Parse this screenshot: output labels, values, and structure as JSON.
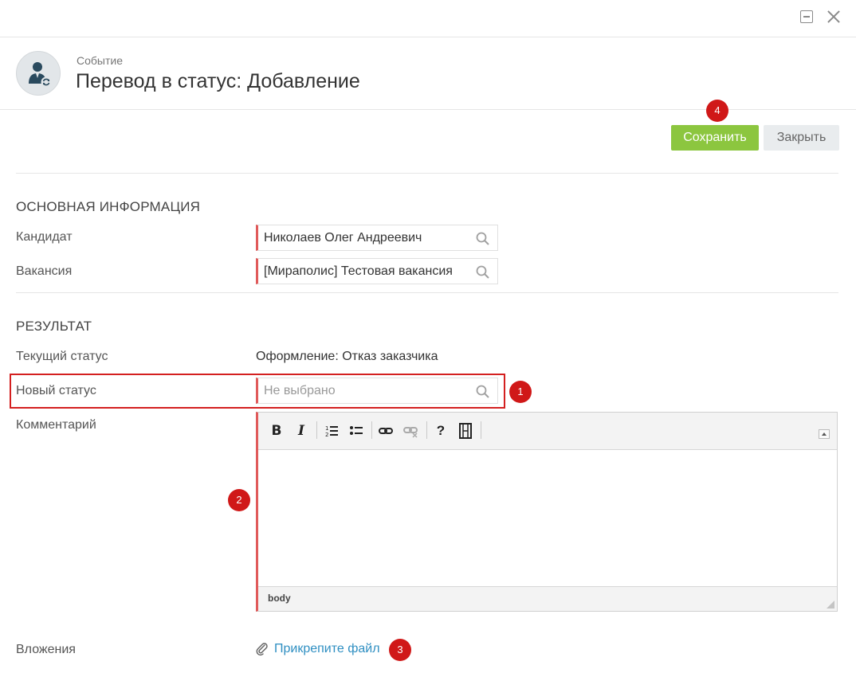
{
  "header": {
    "event_label": "Событие",
    "title": "Перевод в статус: Добавление"
  },
  "actions": {
    "save_label": "Сохранить",
    "close_label": "Закрыть"
  },
  "main_info": {
    "section_title": "ОСНОВНАЯ ИНФОРМАЦИЯ",
    "candidate_label": "Кандидат",
    "candidate_value": "Николаев Олег Андреевич",
    "vacancy_label": "Вакансия",
    "vacancy_value": "[Мираполис] Тестовая вакансия"
  },
  "result": {
    "section_title": "РЕЗУЛЬТАТ",
    "current_status_label": "Текущий статус",
    "current_status_value": "Оформление: Отказ заказчика",
    "new_status_label": "Новый статус",
    "new_status_placeholder": "Не выбрано",
    "comment_label": "Комментарий",
    "editor_path": "body",
    "attachments_label": "Вложения",
    "attach_link": "Прикрепите файл"
  },
  "markers": [
    "1",
    "2",
    "3",
    "4"
  ],
  "colors": {
    "save_button": "#8cc63f",
    "required_bar": "#e05a5a",
    "marker": "#d01818",
    "link": "#2f8fc2"
  },
  "icons": [
    "minimize-icon",
    "close-icon",
    "user-avatar-icon",
    "search-icon",
    "bold-icon",
    "italic-icon",
    "numbered-list-icon",
    "bulleted-list-icon",
    "link-icon",
    "unlink-icon",
    "help-icon",
    "media-icon",
    "paperclip-icon"
  ]
}
